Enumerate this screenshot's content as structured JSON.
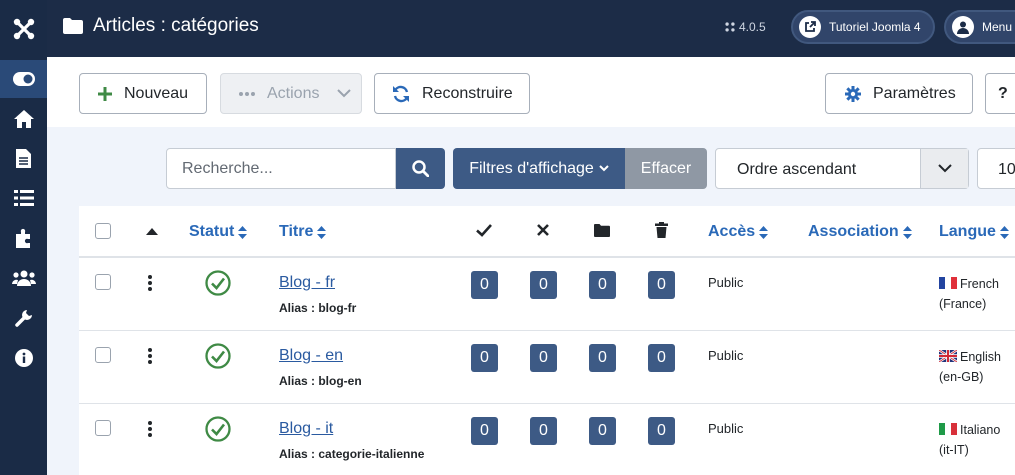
{
  "header": {
    "title": "Articles : catégories",
    "version": "4.0.5",
    "tutorial_label": "Tutoriel Joomla 4",
    "menu_label": "Menu"
  },
  "toolbar": {
    "new_label": "Nouveau",
    "actions_label": "Actions",
    "rebuild_label": "Reconstruire",
    "options_label": "Paramètres"
  },
  "filters": {
    "search_placeholder": "Recherche...",
    "filter_label": "Filtres d'affichage",
    "clear_label": "Effacer",
    "ordering_value": "Ordre ascendant",
    "limit_value": "10"
  },
  "table": {
    "headers": {
      "status": "Statut",
      "title": "Titre",
      "access": "Accès",
      "association": "Association",
      "language": "Langue"
    },
    "rows": [
      {
        "title": "Blog - fr",
        "alias": "Alias : blog-fr",
        "published": "0",
        "unpublished": "0",
        "archived": "0",
        "trashed": "0",
        "access": "Public",
        "language": "French",
        "language_code": "(France)",
        "flag": "fr"
      },
      {
        "title": "Blog - en",
        "alias": "Alias : blog-en",
        "published": "0",
        "unpublished": "0",
        "archived": "0",
        "trashed": "0",
        "access": "Public",
        "language": "English",
        "language_code": "(en-GB)",
        "flag": "gb"
      },
      {
        "title": "Blog - it",
        "alias": "Alias : categorie-italienne",
        "published": "0",
        "unpublished": "0",
        "archived": "0",
        "trashed": "0",
        "access": "Public",
        "language": "Italiano",
        "language_code": "(it-IT)",
        "flag": "it"
      }
    ]
  },
  "sidebar": {
    "items": [
      "toggle-menu",
      "home",
      "content",
      "menus",
      "components",
      "users",
      "system",
      "help"
    ]
  },
  "colors": {
    "header_bg": "#1c2c47",
    "sidebar_bg": "#1a2b46",
    "accent": "#3d5a85",
    "link": "#2a69b8",
    "success": "#3f8a45"
  }
}
